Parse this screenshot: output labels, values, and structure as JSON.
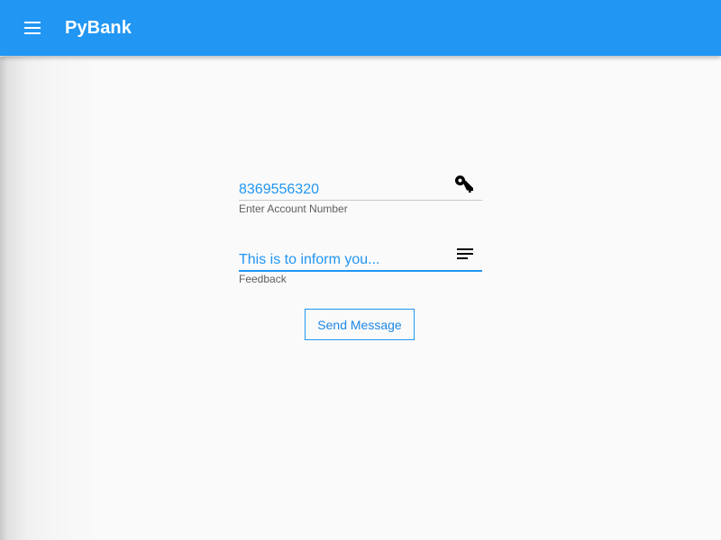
{
  "app": {
    "title": "PyBank"
  },
  "toolbar": {
    "menu_icon": "hamburger-menu-icon",
    "background_color": "#2196f3"
  },
  "form": {
    "account_field": {
      "value": "8369556320",
      "helper_text": "Enter Account Number",
      "icon": "key-icon"
    },
    "feedback_field": {
      "value": "This is to inform you...",
      "helper_text": "Feedback",
      "icon": "text-lines-icon"
    },
    "send_button_label": "Send Message"
  },
  "colors": {
    "accent": "#2196f3",
    "background": "#fafafa",
    "helper_text": "#5f5f5f"
  }
}
